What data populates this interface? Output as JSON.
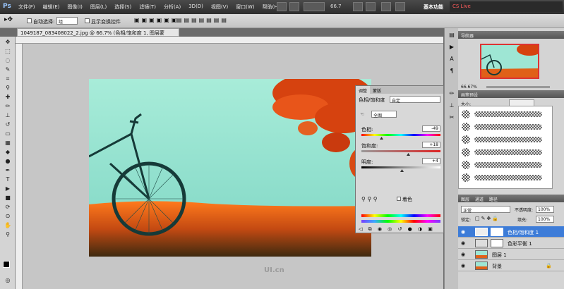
{
  "app": {
    "logo": "Ps"
  },
  "menu": [
    "文件(F)",
    "编辑(E)",
    "图像(I)",
    "图层(L)",
    "选择(S)",
    "滤镜(T)",
    "分析(A)",
    "3D(D)",
    "视图(V)",
    "窗口(W)",
    "帮助(H)"
  ],
  "zoom": "66.7",
  "workspace": "基本功能",
  "live": "CS Live",
  "options": {
    "auto_select": "自动选择:",
    "group": "组",
    "transform": "显示变换控件"
  },
  "document": {
    "tab_title": "1049187_083408022_2.jpg @ 66.7% (色相/饱和度 1, 图层蒙版/8) *"
  },
  "adjustments": {
    "tabs": [
      "调整",
      "蒙版"
    ],
    "title": "色相/饱和度",
    "preset": "自定",
    "channel": "全图",
    "hue_label": "色相:",
    "hue_value": "-49",
    "sat_label": "饱和度:",
    "sat_value": "+18",
    "light_label": "明度:",
    "light_value": "+4",
    "colorize": "着色"
  },
  "navigator": {
    "tabs": [
      "导航器"
    ],
    "zoom": "66.67%"
  },
  "brushes": {
    "tab": "画笔预设",
    "size_label": "大小:"
  },
  "layers": {
    "tabs": [
      "图层",
      "通道",
      "路径"
    ],
    "blend": "正常",
    "opacity_label": "不透明度:",
    "opacity": "100%",
    "lock_label": "锁定:",
    "fill_label": "填充:",
    "fill": "100%",
    "items": [
      {
        "name": "色相/饱和度 1",
        "selected": true
      },
      {
        "name": "色彩平衡 1",
        "selected": false
      },
      {
        "name": "图层 1",
        "selected": false
      },
      {
        "name": "背景",
        "selected": false
      }
    ]
  },
  "watermark": "UI.cn"
}
